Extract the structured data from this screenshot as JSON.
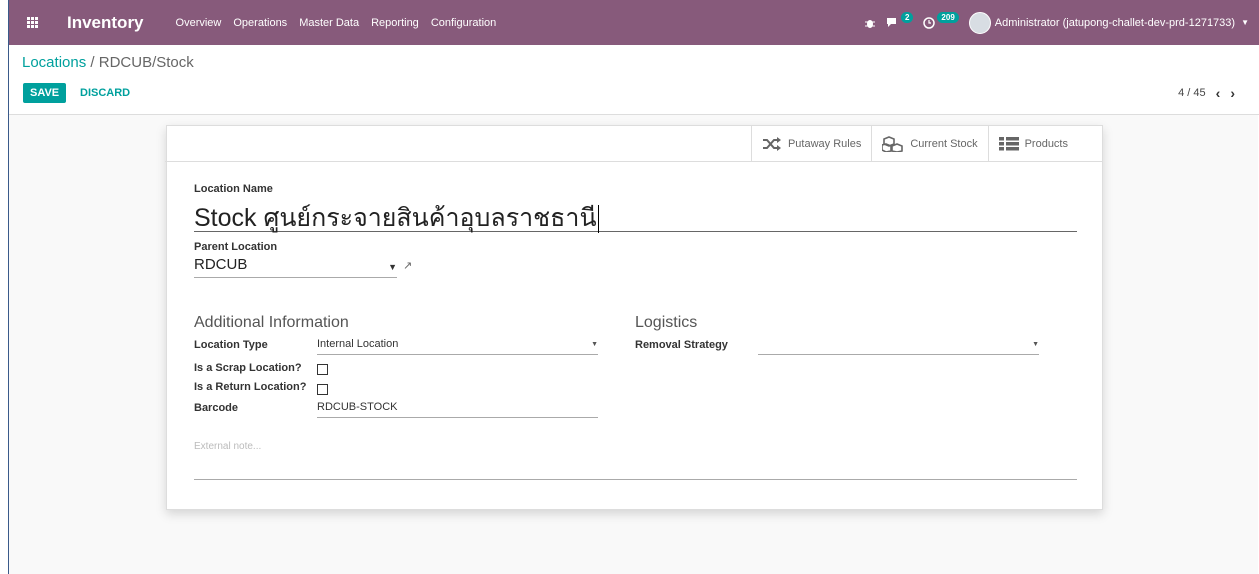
{
  "navbar": {
    "app_title": "Inventory",
    "menu": [
      "Overview",
      "Operations",
      "Master Data",
      "Reporting",
      "Configuration"
    ],
    "messages_badge": "2",
    "activities_badge": "209",
    "user": "Administrator (jatupong-challet-dev-prd-1271733)",
    "color": "#875a7b"
  },
  "breadcrumb": {
    "parent": "Locations",
    "separator": " / ",
    "current": "RDCUB/Stock"
  },
  "actions": {
    "save": "SAVE",
    "discard": "DISCARD",
    "accent": "#00a09d"
  },
  "pager": {
    "value": "4 / 45"
  },
  "button_box": {
    "putaway": "Putaway Rules",
    "current_stock": "Current Stock",
    "products": "Products"
  },
  "form": {
    "location_name_label": "Location Name",
    "location_name": "Stock ศูนย์กระจายสินค้าอุบลราชธานี",
    "parent_label": "Parent Location",
    "parent_value": "RDCUB",
    "additional_title": "Additional Information",
    "logistics_title": "Logistics",
    "location_type_label": "Location Type",
    "location_type_value": "Internal Location",
    "scrap_label": "Is a Scrap Location?",
    "return_label": "Is a Return Location?",
    "barcode_label": "Barcode",
    "barcode_value": "RDCUB-STOCK",
    "removal_label": "Removal Strategy",
    "removal_value": "",
    "note_placeholder": "External note..."
  }
}
